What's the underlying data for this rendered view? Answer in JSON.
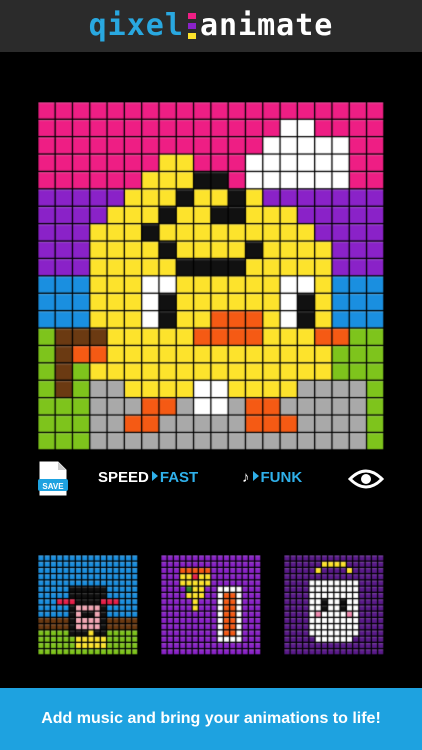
{
  "app": {
    "logo_left": "qixel",
    "logo_right": "animate"
  },
  "toolbar": {
    "save_label": "SAVE",
    "speed_label": "SPEED",
    "speed_value": "FAST",
    "music_value": "FUNK"
  },
  "gallery": [
    {
      "name": "girl-with-bow"
    },
    {
      "name": "pizza-and-drink"
    },
    {
      "name": "angel-ghost"
    }
  ],
  "banner": {
    "text": "Add music and bring your animations to life!"
  },
  "colors": {
    "accent": "#1ea2e0",
    "header_bg": "#2b2b2b",
    "pink": "#ee1e84",
    "purple": "#8a22c8",
    "blue": "#1a8fe0",
    "green": "#7ec41c",
    "yellow": "#fde32c",
    "orange": "#f55a14"
  }
}
